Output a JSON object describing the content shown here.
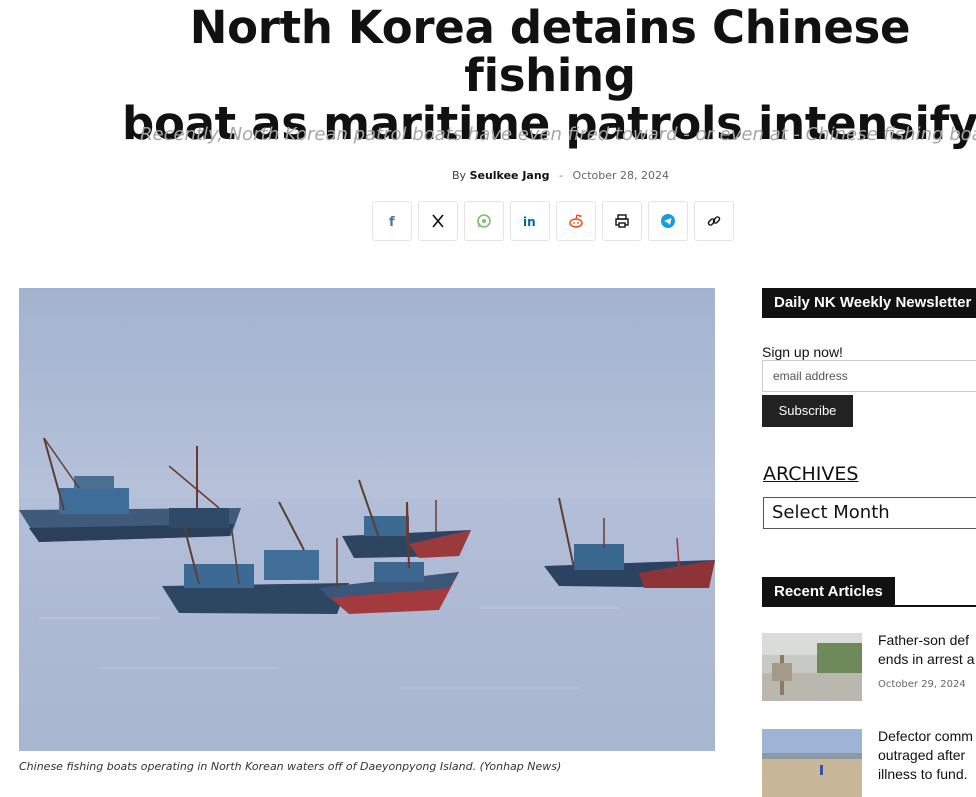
{
  "article": {
    "title_line1": "North Korea detains Chinese fishing",
    "title_line2": "boat as maritime patrols intensify",
    "subtitle": "Recently, North Korean patrol boats have even fired toward - or even at - Chinese fishing boats",
    "by_label": "By",
    "author": "Seulkee Jang",
    "separator": "-",
    "date": "October 28, 2024",
    "image_caption": "Chinese fishing boats operating in North Korean waters off of Daeyonpyong Island. (Yonhap News)"
  },
  "share_buttons": [
    {
      "name": "facebook",
      "glyph": "f",
      "color": "#516eab"
    },
    {
      "name": "x",
      "glyph": "X",
      "color": "#111111"
    },
    {
      "name": "whatsapp",
      "glyph": "whatsapp",
      "color": "#7bbf6a"
    },
    {
      "name": "linkedin",
      "glyph": "in",
      "color": "#0266a0"
    },
    {
      "name": "reddit",
      "glyph": "reddit",
      "color": "#f54200"
    },
    {
      "name": "print",
      "glyph": "print",
      "color": "#111111"
    },
    {
      "name": "telegram",
      "glyph": "telegram",
      "color": "#179cde"
    },
    {
      "name": "copy-link",
      "glyph": "link",
      "color": "#111111"
    }
  ],
  "sidebar": {
    "newsletter_title": "Daily NK Weekly Newsletter",
    "signup_text": "Sign up now!",
    "email_placeholder": "email address",
    "subscribe_label": "Subscribe",
    "archives_title": "ARCHIVES",
    "archives_select": "Select Month",
    "recent_title": "Recent Articles",
    "recent_articles": [
      {
        "line1": "Father-son def",
        "line2": "ends in arrest a",
        "date": "October 29, 2024"
      },
      {
        "line1": "Defector comm",
        "line2": "outraged after",
        "line3": "illness to fund."
      }
    ]
  }
}
